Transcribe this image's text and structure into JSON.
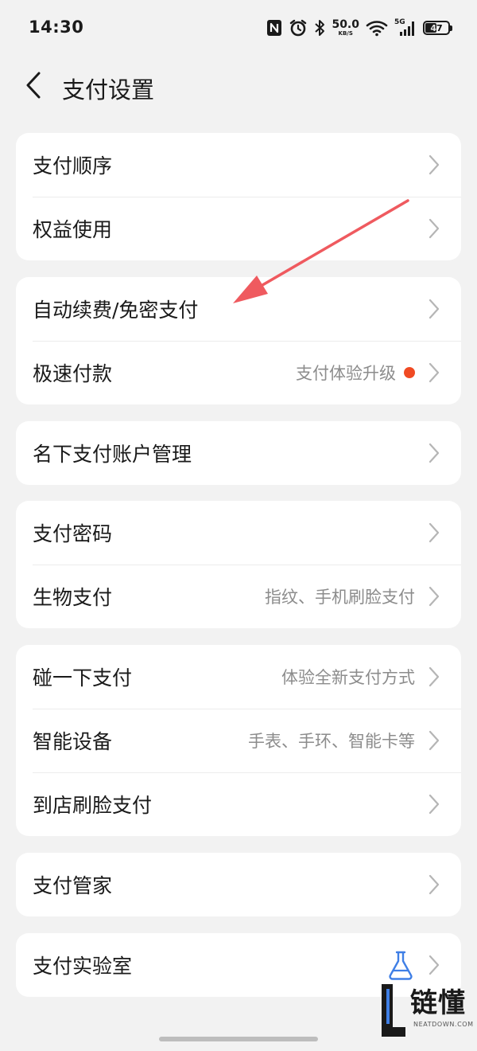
{
  "status_bar": {
    "time": "14:30",
    "net_speed": "50.0",
    "net_unit": "KB/S",
    "network_type": "5G",
    "battery": "47",
    "icons": [
      "nfc-icon",
      "alarm-icon",
      "bluetooth-icon",
      "wifi-icon",
      "signal-icon",
      "battery-icon"
    ]
  },
  "header": {
    "title": "支付设置",
    "back_icon": "chevron-left-icon"
  },
  "sections": [
    {
      "items": [
        {
          "label": "支付顺序",
          "sub": ""
        },
        {
          "label": "权益使用",
          "sub": ""
        }
      ]
    },
    {
      "items": [
        {
          "label": "自动续费/免密支付",
          "sub": ""
        },
        {
          "label": "极速付款",
          "sub": "支付体验升级",
          "badge": "red-dot"
        }
      ]
    },
    {
      "items": [
        {
          "label": "名下支付账户管理",
          "sub": ""
        }
      ]
    },
    {
      "items": [
        {
          "label": "支付密码",
          "sub": ""
        },
        {
          "label": "生物支付",
          "sub": "指纹、手机刷脸支付"
        }
      ]
    },
    {
      "items": [
        {
          "label": "碰一下支付",
          "sub": "体验全新支付方式"
        },
        {
          "label": "智能设备",
          "sub": "手表、手环、智能卡等"
        },
        {
          "label": "到店刷脸支付",
          "sub": ""
        }
      ]
    },
    {
      "items": [
        {
          "label": "支付管家",
          "sub": ""
        }
      ]
    },
    {
      "items": [
        {
          "label": "支付实验室",
          "sub": "",
          "icon": "flask-icon"
        }
      ]
    }
  ],
  "watermark": {
    "text": "链懂",
    "sub": "NEATDOWN.COM"
  },
  "colors": {
    "background": "#f2f2f2",
    "card": "#ffffff",
    "accent_red": "#f04a23",
    "annotation": "#ef5a5f",
    "flask": "#3f7fe6"
  }
}
